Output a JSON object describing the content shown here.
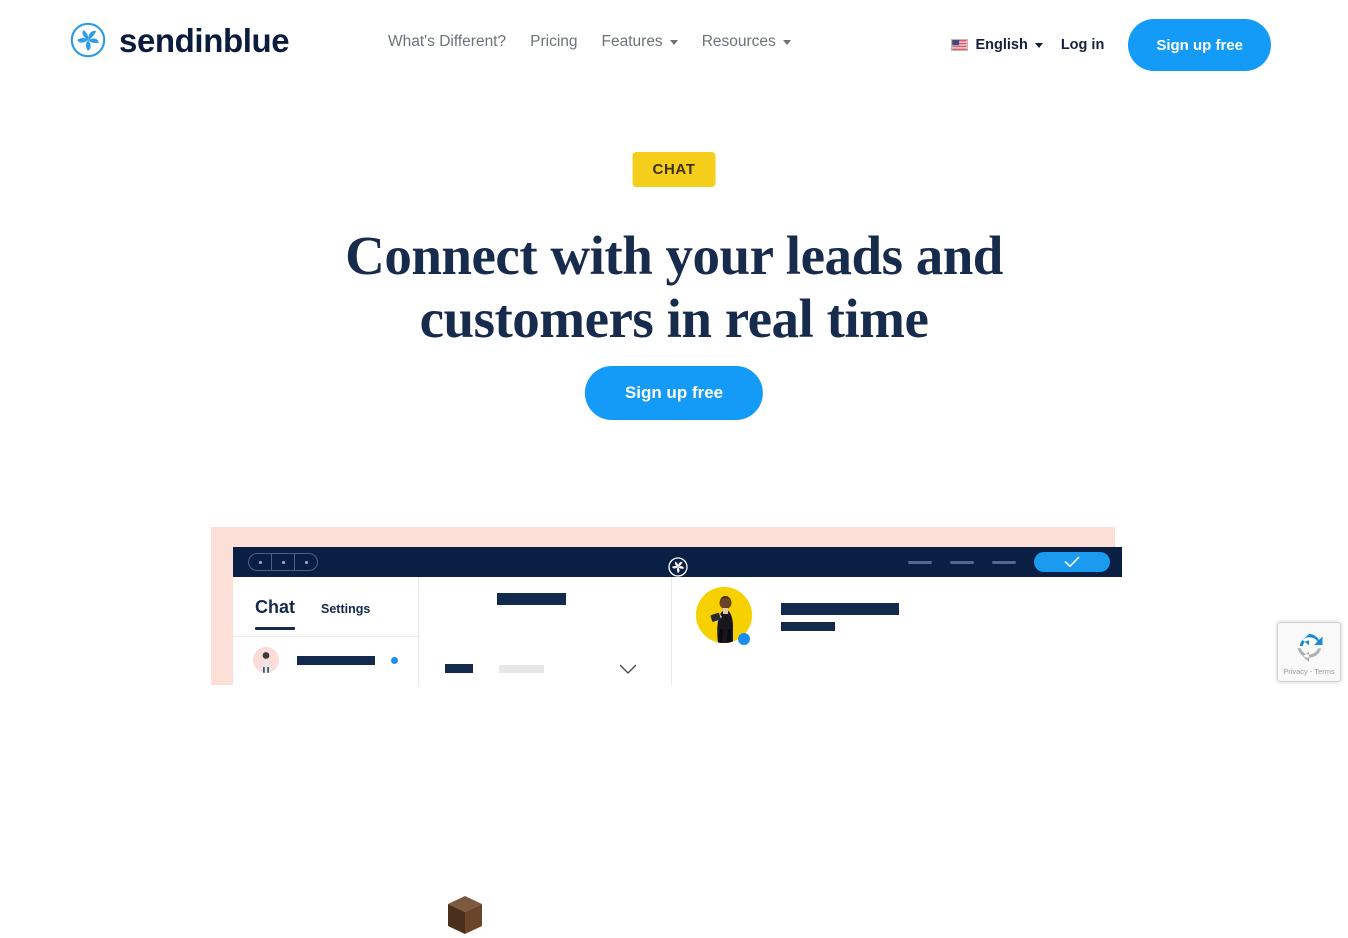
{
  "header": {
    "brand": {
      "name": "sendinblue",
      "icon": "sendinblue-pinwheel-logo",
      "color": "#139bf7"
    },
    "nav": [
      {
        "label": "What's Different?",
        "has_caret": false
      },
      {
        "label": "Pricing",
        "has_caret": false
      },
      {
        "label": "Features",
        "has_caret": true
      },
      {
        "label": "Resources",
        "has_caret": true
      }
    ],
    "language": {
      "label": "English",
      "flag": "us-flag-icon"
    },
    "login_label": "Log in",
    "signup_label": "Sign up free"
  },
  "hero": {
    "eyebrow": "CHAT",
    "title_line1": "Connect with your leads and",
    "title_line2": "customers in real time",
    "cta_label": "Sign up free",
    "title_color": "#172b4d",
    "eyebrow_bg": "#f5ce1c",
    "accent_color": "#139bf7"
  },
  "decor": {
    "cube_alt": "brown-3d-box"
  },
  "mockup": {
    "panel_bg": "#fcdfd7",
    "topbar_bg": "#0a1f44",
    "topbar": {
      "window_dots": 3,
      "logo": "sendinblue-pinwheel-logo",
      "dashes": 3,
      "check_button": "checkmark-icon"
    },
    "chat_panel": {
      "tab_active": "Chat",
      "tab_inactive": "Settings",
      "list_item_avatar": "woman-avatar-pink",
      "unread_dot_color": "#1a8df0"
    },
    "mid_panel": {
      "placeholder_bars": 3,
      "chevron": "chevron-down-icon"
    },
    "right_panel": {
      "avatar": "businesswoman-avatar-yellow",
      "status_color": "#1a8df0",
      "placeholder_bars": 2
    }
  },
  "recaptcha": {
    "text": "Privacy - Terms",
    "icon": "recaptcha-icon"
  }
}
